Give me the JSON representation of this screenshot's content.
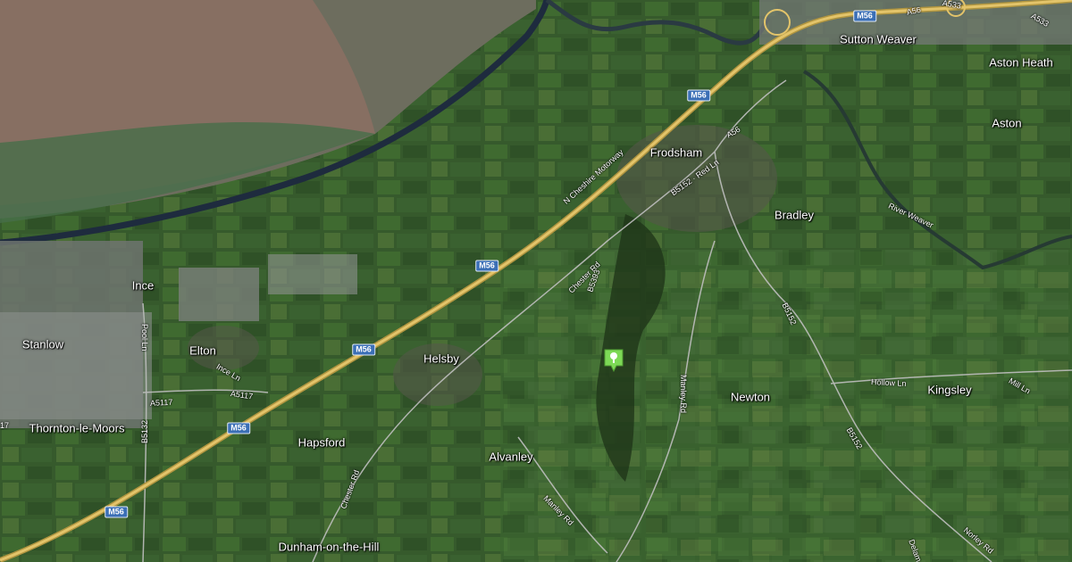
{
  "map": {
    "style": "satellite",
    "colors": {
      "motorway": "#e3c46a",
      "road": "#c7c7c7",
      "shield": "#3b6fb6",
      "poi": "#7dd956"
    },
    "places": {
      "sutton_weaver": "Sutton Weaver",
      "aston_heath": "Aston Heath",
      "aston": "Aston",
      "frodsham": "Frodsham",
      "bradley": "Bradley",
      "ince": "Ince",
      "stanlow": "Stanlow",
      "elton": "Elton",
      "helsby": "Helsby",
      "newton": "Newton",
      "kingsley": "Kingsley",
      "thornton_le_moors": "Thornton-le-Moors",
      "hapsford": "Hapsford",
      "alvanley": "Alvanley",
      "dunham_on_the_hill": "Dunham-on-the-Hill"
    },
    "road_labels": {
      "a56_top": "A56",
      "a533": "A533",
      "a533_b": "A533",
      "a56_frodsham": "A56",
      "n_cheshire_motorway": "N Cheshire Motorway",
      "b5152_red_ln": "B5152 · Red Ln",
      "river_weaver": "River Weaver",
      "chester_rd_1": "Chester Rd",
      "b5393": "B5393",
      "b5152_a": "B5152",
      "b5152_b": "B5152",
      "poole_ln": "Pool Ln",
      "ince_ln": "Ince Ln",
      "a5117_a": "A5117",
      "a5117_b": "A5117",
      "manley_rd_1": "Manley Rd",
      "manley_rd_2": "Manley Rd",
      "hollow_ln": "Hollow Ln",
      "mill_ln": "Mill Ln",
      "b5132": "B5132",
      "chester_rd_2": "Chester Rd",
      "norley_rd": "Norley Rd",
      "delamere": "Delam",
      "seventeen": "17"
    },
    "shields": {
      "m56_top": "M56",
      "m56_frodsham": "M56",
      "m56_mid": "M56",
      "m56_helsby": "M56",
      "m56_hapsford": "M56",
      "m56_bottom": "M56"
    },
    "poi_icon": "park-marker-icon"
  }
}
